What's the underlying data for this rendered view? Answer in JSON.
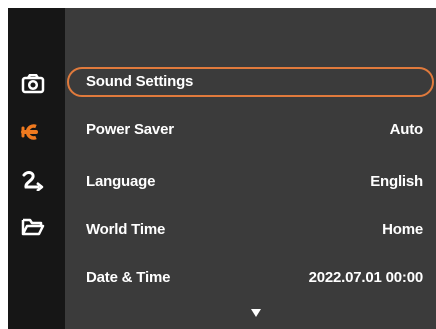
{
  "sidebar": {
    "icons": [
      {
        "name": "camera-icon",
        "color": "#ffffff"
      },
      {
        "name": "wrench-icon",
        "color": "#f07a1f",
        "active": true
      },
      {
        "name": "playback-icon",
        "color": "#ffffff"
      },
      {
        "name": "folder-icon",
        "color": "#ffffff"
      }
    ]
  },
  "menu": {
    "items": [
      {
        "label": "Sound Settings",
        "value": "",
        "selected": true
      },
      {
        "label": "Power Saver",
        "value": "Auto"
      },
      {
        "label": "Language",
        "value": "English"
      },
      {
        "label": "World Time",
        "value": "Home"
      },
      {
        "label": "Date & Time",
        "value": "2022.07.01 00:00"
      }
    ],
    "more_indicator": "down-arrow-icon"
  },
  "colors": {
    "accent": "#e07a3c",
    "sidebar_bg": "#161616",
    "main_bg": "#3b3b3b",
    "text": "#ffffff"
  }
}
